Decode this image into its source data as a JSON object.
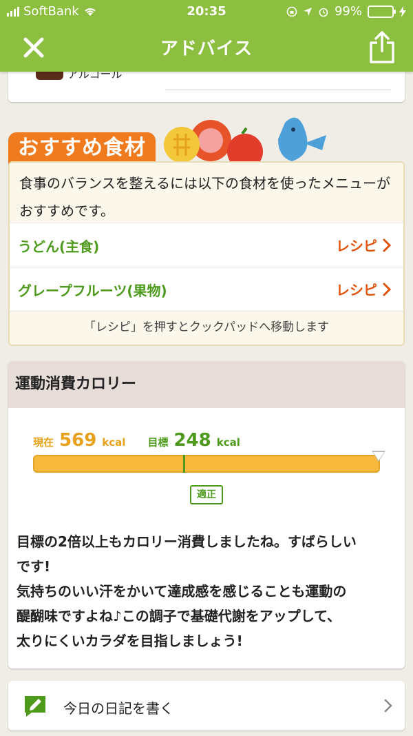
{
  "status_bar": {
    "carrier": "SoftBank",
    "time": "20:35",
    "battery": "99%"
  },
  "nav": {
    "title": "アドバイス"
  },
  "previous_card": {
    "category": "アルコール"
  },
  "recommended": {
    "title": "おすすめ食材",
    "intro": "食事のバランスを整えるには以下の食材を使ったメニューがおすすめです。",
    "items": [
      {
        "name": "うどん(主食)",
        "recipe_label": "レシピ"
      },
      {
        "name": "グレープフルーツ(果物)",
        "recipe_label": "レシピ"
      }
    ],
    "note": "「レシピ」を押すとクックパッドへ移動します"
  },
  "exercise": {
    "title": "運動消費カロリー",
    "current_label": "現在",
    "current_value": "569",
    "goal_label": "目標",
    "goal_value": "248",
    "unit": "kcal",
    "badge": "適正",
    "message_lines": [
      "目標の2倍以上もカロリー消費しましたね。すばらしい",
      "です!",
      "気持ちのいい汗をかいて達成感を感じることも運動の",
      "醍醐味ですよね♪この調子で基礎代謝をアップして、",
      "太りにくいカラダを目指しましょう!"
    ]
  },
  "diary": {
    "label": "今日の日記を書く"
  },
  "colors": {
    "header_green": "#8cbf3f",
    "accent_orange": "#f07a1e",
    "recipe_red": "#e1530f",
    "bar_yellow": "#f6b93c"
  }
}
